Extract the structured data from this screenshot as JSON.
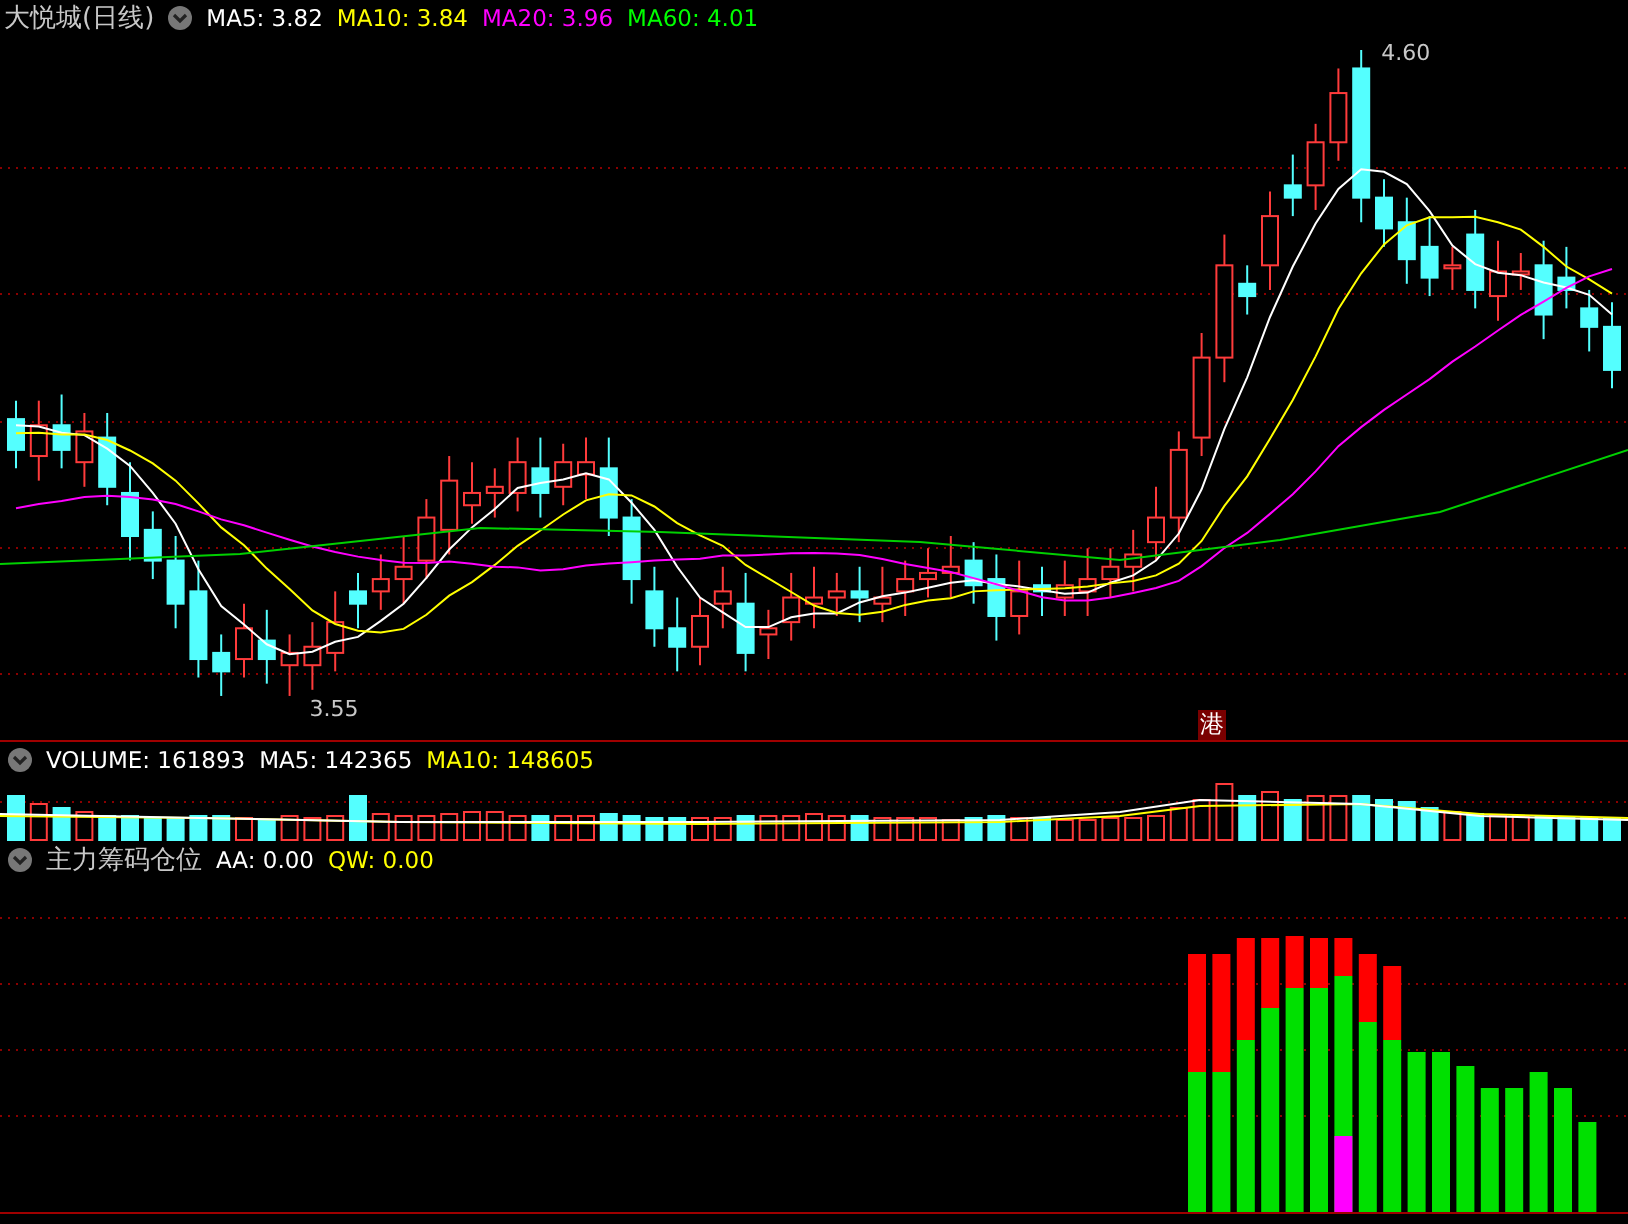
{
  "price_header": {
    "title": "大悦城(日线)",
    "indicators": [
      {
        "label": "MA5: 3.82",
        "color": "#ffffff"
      },
      {
        "label": "MA10: 3.84",
        "color": "#ffff00"
      },
      {
        "label": "MA20: 3.96",
        "color": "#ff00ff"
      },
      {
        "label": "MA60: 4.01",
        "color": "#00ff00"
      }
    ]
  },
  "price_chart": {
    "high_label": "4.60",
    "low_label": "3.55",
    "badge": "港"
  },
  "volume_header": {
    "indicators": [
      {
        "label": "VOLUME: 161893",
        "color": "#ffffff"
      },
      {
        "label": "MA5: 142365",
        "color": "#ffffff"
      },
      {
        "label": "MA10: 148605",
        "color": "#ffff00"
      }
    ]
  },
  "chip_header": {
    "title": "主力筹码仓位",
    "indicators": [
      {
        "label": "AA: 0.00",
        "color": "#ffffff"
      },
      {
        "label": "QW: 0.00",
        "color": "#ffff00"
      }
    ]
  }
}
